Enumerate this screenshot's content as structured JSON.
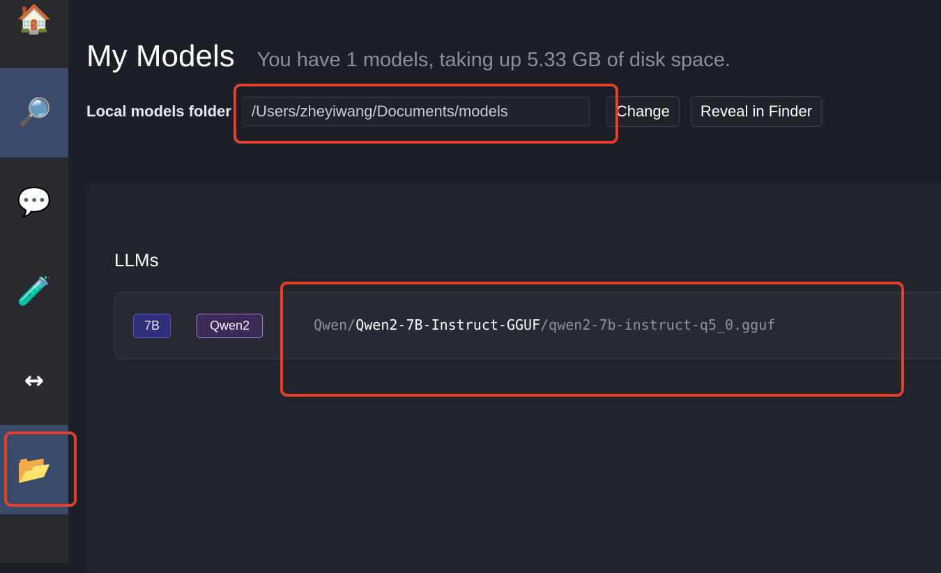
{
  "sidebar": {
    "items": [
      {
        "name": "home",
        "icon": "house-icon",
        "glyph": "🏠"
      },
      {
        "name": "search",
        "icon": "magnifier-icon",
        "glyph": "🔎"
      },
      {
        "name": "chat",
        "icon": "speech-bubble-icon",
        "glyph": "💬"
      },
      {
        "name": "lab",
        "icon": "test-tube-icon",
        "glyph": "🧪"
      },
      {
        "name": "server",
        "icon": "left-right-arrow-icon",
        "glyph": "↔"
      },
      {
        "name": "my-models",
        "icon": "open-folder-icon",
        "glyph": "📂"
      }
    ],
    "active": "my-models"
  },
  "header": {
    "title": "My Models",
    "subtitle": "You have 1 models, taking up 5.33 GB of disk space."
  },
  "folder": {
    "label": "Local models folder",
    "path": "/Users/zheyiwang/Documents/models",
    "change_label": "Change",
    "reveal_label": "Reveal in Finder"
  },
  "llms": {
    "section_label": "LLMs",
    "models": [
      {
        "size_badge": "7B",
        "arch_badge": "Qwen2",
        "publisher": "Qwen",
        "sep1": "/",
        "repo": "Qwen2-7B-Instruct-GGUF",
        "sep2": "/",
        "file": "qwen2-7b-instruct-q5_0.gguf"
      }
    ]
  },
  "colors": {
    "highlight": "#e0402d",
    "active_sidebar": "#3a4a6b",
    "size_badge": "#2f2f7a",
    "arch_badge": "#3b2a55"
  }
}
